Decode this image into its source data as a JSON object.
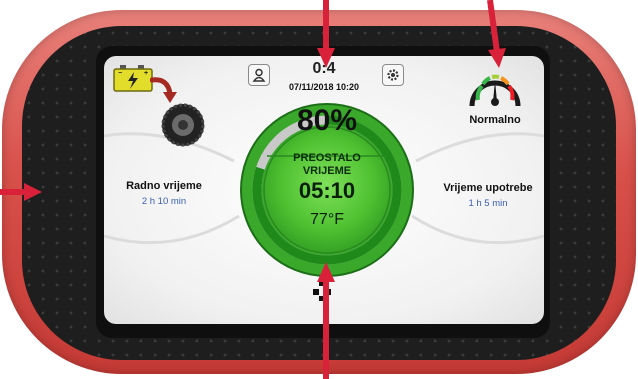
{
  "header": {
    "clock": "0:4",
    "datetime": "07/11/2018 10:20"
  },
  "gauge": {
    "percent": "80%",
    "remaining_label": "PREOSTALO VRIJEME",
    "remaining_time": "05:10",
    "temperature": "77°F",
    "level": 0.8
  },
  "left_panel": {
    "label": "Radno vrijeme",
    "value": "2 h 10 min"
  },
  "right_panel": {
    "label": "Vrijeme upotrebe",
    "value": "1 h 5 min"
  },
  "speed_status": {
    "label": "Normalno"
  },
  "icons": {
    "battery": "battery-charge-icon",
    "tire": "tire-icon",
    "user": "user-icon",
    "settings": "gear-icon",
    "speedometer": "speedometer-icon",
    "menu": "menu-dots-icon"
  },
  "colors": {
    "frame": "#d8504a",
    "ring_green": "#3cb02e",
    "arrow": "#d9223a",
    "value_blue": "#3a5fb0"
  }
}
